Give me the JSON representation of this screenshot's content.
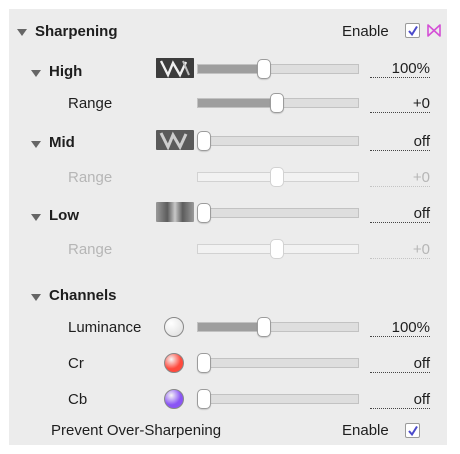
{
  "sharpening": {
    "title": "Sharpening",
    "enable_label": "Enable",
    "enabled": true,
    "bookmark_icon_color": "#d44fd6"
  },
  "high": {
    "title": "High",
    "amount": "100%",
    "amount_level": 0.41,
    "range_label": "Range",
    "range_value": "+0",
    "range_level": 0.5
  },
  "mid": {
    "title": "Mid",
    "amount": "off",
    "amount_level": 0,
    "range_label": "Range",
    "range_value": "+0",
    "range_level": 0.5
  },
  "low": {
    "title": "Low",
    "amount": "off",
    "amount_level": 0,
    "range_label": "Range",
    "range_value": "+0",
    "range_level": 0.5
  },
  "channels": {
    "title": "Channels",
    "luminance": {
      "label": "Luminance",
      "value": "100%",
      "level": 0.41,
      "swatch": "#ffffff"
    },
    "cr": {
      "label": "Cr",
      "value": "off",
      "level": 0,
      "swatch": "#ff4a3d"
    },
    "cb": {
      "label": "Cb",
      "value": "off",
      "level": 0,
      "swatch": "#8a55f5"
    }
  },
  "prevent": {
    "label": "Prevent Over-Sharpening",
    "enable_label": "Enable",
    "enabled": true
  },
  "colors": {
    "checkbox_accent": "#4b4acb",
    "panel_bg": "#ececec"
  }
}
